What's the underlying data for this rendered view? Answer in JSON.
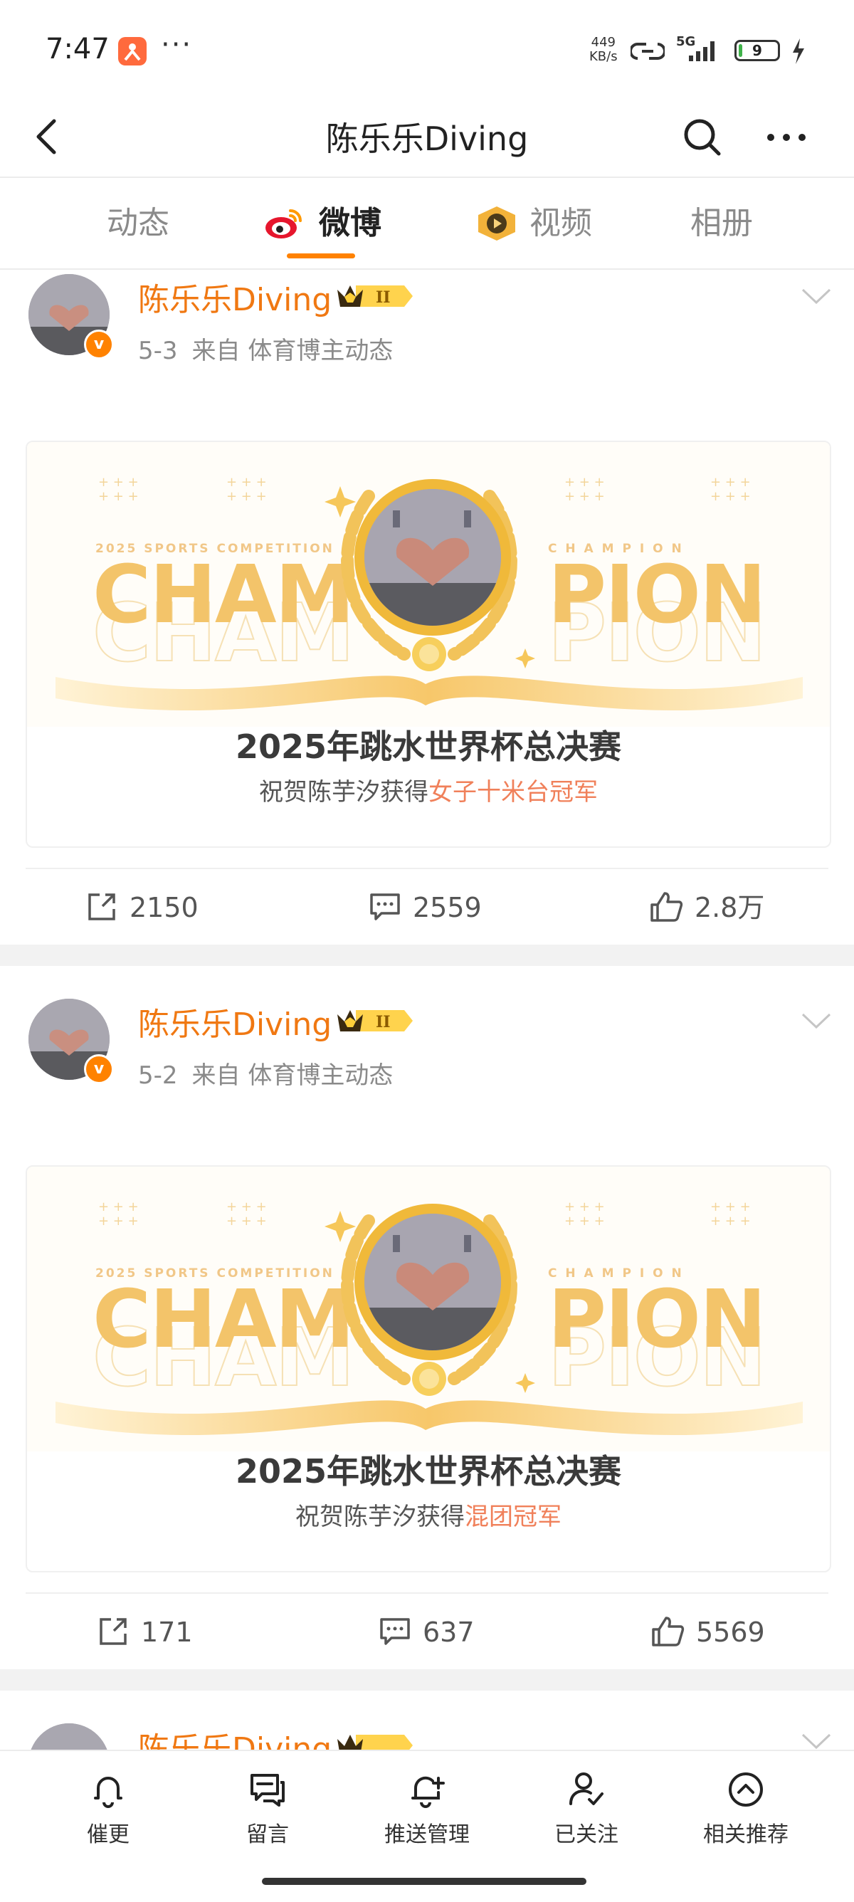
{
  "status_bar": {
    "time": "7:47",
    "more": "···",
    "speed_value": "449",
    "speed_unit": "KB/s",
    "network": "5G",
    "battery": "9",
    "battery_level": 0.09,
    "colors": {
      "app_icon": "#ff6a3d",
      "battery_fill": "#3fb24a"
    }
  },
  "header": {
    "title": "陈乐乐Diving",
    "back_icon": "chevron-left-icon",
    "search_icon": "search-icon",
    "more_icon": "more-horizontal-icon"
  },
  "tabs": [
    {
      "label": "动态",
      "active": false
    },
    {
      "label": "微博",
      "active": true,
      "icon": "weibo-logo-icon"
    },
    {
      "label": "视频",
      "active": false,
      "icon": "video-badge-icon"
    },
    {
      "label": "相册",
      "active": false
    }
  ],
  "accent_color": "#ff8200",
  "author_color": "#f07812",
  "posts": [
    {
      "author": "陈乐乐Diving",
      "date": "5-3",
      "source": "来自 体育博主动态",
      "card": {
        "small_left": "2025 SPORTS COMPETITION",
        "small_right": "C H A M P I O N",
        "word_left": "CHAM",
        "word_right": "PION",
        "title": "2025年跳水世界杯总决赛",
        "subtitle_prefix": "祝贺陈芋汐获得",
        "subtitle_highlight": "女子十米台冠军"
      },
      "reposts": "2150",
      "comments": "2559",
      "likes": "2.8万"
    },
    {
      "author": "陈乐乐Diving",
      "date": "5-2",
      "source": "来自 体育博主动态",
      "card": {
        "small_left": "2025 SPORTS COMPETITION",
        "small_right": "C H A M P I O N",
        "word_left": "CHAM",
        "word_right": "PION",
        "title": "2025年跳水世界杯总决赛",
        "subtitle_prefix": "祝贺陈芋汐获得",
        "subtitle_highlight": "混团冠军"
      },
      "reposts": "171",
      "comments": "637",
      "likes": "5569"
    },
    {
      "author": "陈乐乐Diving"
    }
  ],
  "bottom_bar": [
    {
      "label": "催更",
      "icon": "bell-icon"
    },
    {
      "label": "留言",
      "icon": "message-icon"
    },
    {
      "label": "推送管理",
      "icon": "bell-plus-icon"
    },
    {
      "label": "已关注",
      "icon": "user-check-icon"
    },
    {
      "label": "相关推荐",
      "icon": "chevron-up-circle-icon"
    }
  ]
}
